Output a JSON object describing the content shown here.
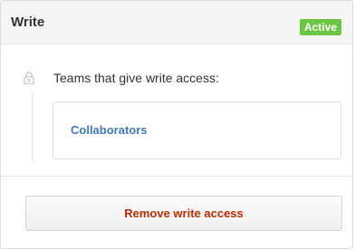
{
  "panel": {
    "title": "Write",
    "status": "Active"
  },
  "teams": {
    "label": "Teams that give write access:",
    "icon": "lock-icon",
    "items": [
      {
        "name": "Collaborators"
      }
    ]
  },
  "actions": {
    "remove_label": "Remove write access"
  },
  "colors": {
    "badge": "#6cc644",
    "link": "#4078c0",
    "danger": "#bd2c00"
  }
}
